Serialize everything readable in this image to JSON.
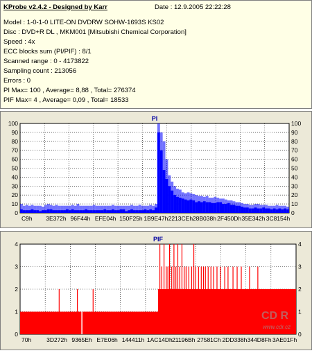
{
  "header": {
    "title": "KProbe v2.4.2 - Designed by Karr",
    "date": "Date : 12.9.2005 22:22:28"
  },
  "info_lines": [
    "Model : 1-0-1-0 LITE-ON DVDRW SOHW-1693S KS02",
    "Disc : DVD+R DL , MKM001 [Mitsubishi Chemical Corporation]",
    "Speed : 4x",
    "ECC blocks sum (PI/PIF) : 8/1",
    "Scanned range : 0 - 4173822",
    "Sampling count : 213056",
    "Errors : 0",
    "PI Max= 100 , Average= 8,88 , Total= 276374",
    "PIF Max= 4 , Average= 0,09 , Total= 18533"
  ],
  "watermark": {
    "logo": "CD R",
    "url": "www.cdr.cz"
  },
  "colors": {
    "pi": "#0000ff",
    "pif": "#ff0000",
    "panel": "#ece9d8",
    "info_bg": "#ffffe6"
  },
  "chart_data": [
    {
      "type": "area",
      "title": "PI",
      "ylim": [
        0,
        100
      ],
      "yticks": [
        "0",
        "10",
        "20",
        "30",
        "40",
        "50",
        "60",
        "70",
        "80",
        "90",
        "100"
      ],
      "xticks": [
        "C9h",
        "3E372h",
        "96F44h",
        "EFE04h",
        "150F25h",
        "1B9E47h",
        "2213CEh",
        "28B038h",
        "2F450Dh",
        "35E342h",
        "3C8154h"
      ],
      "grid": true,
      "series": [
        {
          "values": [
            4,
            3,
            3,
            3,
            4,
            3,
            3,
            2,
            3,
            3,
            4,
            4,
            3,
            3,
            3,
            3,
            3,
            4,
            3,
            4,
            3,
            3,
            3,
            3,
            4,
            3,
            3,
            3,
            3,
            3,
            3,
            4,
            3,
            3,
            4,
            3,
            3,
            4,
            4,
            2,
            3,
            4,
            3,
            3,
            3,
            3,
            4,
            3,
            4,
            3,
            6,
            90,
            70,
            48,
            38,
            30,
            25,
            20,
            18,
            17,
            16,
            15,
            14,
            15,
            14,
            12,
            13,
            12,
            13,
            12,
            12,
            11,
            11,
            12,
            12,
            10,
            10,
            11,
            9,
            9,
            8,
            8,
            7,
            6,
            6,
            5,
            5,
            6,
            5,
            5,
            6,
            5,
            5,
            4,
            5,
            4,
            5,
            4,
            5,
            4
          ],
          "peaks": [
            10,
            8,
            9,
            8,
            9,
            8,
            8,
            8,
            7,
            9,
            10,
            9,
            8,
            9,
            8,
            8,
            8,
            8,
            8,
            9,
            8,
            10,
            8,
            8,
            8,
            8,
            8,
            9,
            8,
            8,
            8,
            8,
            8,
            8,
            9,
            8,
            8,
            8,
            8,
            8,
            8,
            9,
            8,
            8,
            9,
            8,
            8,
            8,
            9,
            8,
            10,
            100,
            90,
            80,
            60,
            42,
            35,
            30,
            27,
            26,
            23,
            22,
            23,
            22,
            21,
            20,
            19,
            19,
            18,
            19,
            17,
            17,
            18,
            17,
            16,
            16,
            15,
            14,
            14,
            13,
            12,
            12,
            11,
            10,
            10,
            9,
            9,
            10,
            10,
            9,
            9,
            9,
            8,
            8,
            8,
            9,
            8,
            8,
            8,
            7
          ]
        }
      ]
    },
    {
      "type": "bar",
      "title": "PIF",
      "ylim": [
        0,
        4
      ],
      "yticks": [
        "0",
        "1",
        "2",
        "3",
        "4"
      ],
      "xticks": [
        "70h",
        "3D272h",
        "9365Eh",
        "E7E06h",
        "144411h",
        "1AC14Dh",
        "21196Bh",
        "27581Ch",
        "2DD338h",
        "344D8Fh",
        "3AE01Fh"
      ],
      "grid": true,
      "baseline_before": 1,
      "baseline_after": 2,
      "switch_fraction": 0.5,
      "dips_to_zero": [
        0.222
      ],
      "spikes_before": [
        {
          "pos": 0.14,
          "v": 2
        },
        {
          "pos": 0.206,
          "v": 2
        },
        {
          "pos": 0.263,
          "v": 2
        }
      ],
      "spikes_after": [
        {
          "pos": 0.505,
          "v": 4
        },
        {
          "pos": 0.512,
          "v": 3
        },
        {
          "pos": 0.52,
          "v": 4
        },
        {
          "pos": 0.528,
          "v": 3
        },
        {
          "pos": 0.534,
          "v": 3
        },
        {
          "pos": 0.54,
          "v": 4
        },
        {
          "pos": 0.548,
          "v": 3
        },
        {
          "pos": 0.556,
          "v": 4
        },
        {
          "pos": 0.563,
          "v": 3
        },
        {
          "pos": 0.57,
          "v": 4
        },
        {
          "pos": 0.577,
          "v": 3
        },
        {
          "pos": 0.585,
          "v": 4
        },
        {
          "pos": 0.593,
          "v": 3
        },
        {
          "pos": 0.6,
          "v": 3
        },
        {
          "pos": 0.61,
          "v": 3
        },
        {
          "pos": 0.62,
          "v": 3
        },
        {
          "pos": 0.628,
          "v": 4
        },
        {
          "pos": 0.635,
          "v": 3
        },
        {
          "pos": 0.645,
          "v": 3
        },
        {
          "pos": 0.655,
          "v": 3
        },
        {
          "pos": 0.663,
          "v": 3
        },
        {
          "pos": 0.67,
          "v": 3
        },
        {
          "pos": 0.68,
          "v": 3
        },
        {
          "pos": 0.69,
          "v": 3
        },
        {
          "pos": 0.7,
          "v": 3
        },
        {
          "pos": 0.712,
          "v": 3
        },
        {
          "pos": 0.724,
          "v": 3
        },
        {
          "pos": 0.74,
          "v": 3
        },
        {
          "pos": 0.752,
          "v": 3
        },
        {
          "pos": 0.77,
          "v": 3
        },
        {
          "pos": 0.785,
          "v": 3
        },
        {
          "pos": 0.8,
          "v": 3
        },
        {
          "pos": 0.83,
          "v": 3
        },
        {
          "pos": 0.86,
          "v": 3
        }
      ]
    }
  ]
}
